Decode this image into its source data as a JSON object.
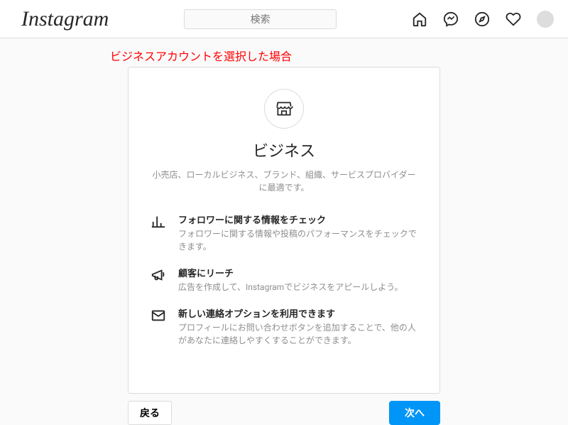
{
  "header": {
    "logo_text": "Instagram",
    "search_placeholder": "検索"
  },
  "annotation": "ビジネスアカウントを選択した場合",
  "card": {
    "title": "ビジネス",
    "subtitle": "小売店、ローカルビジネス、ブランド、組織、サービスプロバイダーに最適です。",
    "features": [
      {
        "title": "フォロワーに関する情報をチェック",
        "desc": "フォロワーに関する情報や投稿のパフォーマンスをチェックできます。"
      },
      {
        "title": "顧客にリーチ",
        "desc": "広告を作成して、Instagramでビジネスをアピールしよう。"
      },
      {
        "title": "新しい連絡オプションを利用できます",
        "desc": "プロフィールにお問い合わせボタンを追加することで、他の人があなたに連絡しやすくすることができます。"
      }
    ]
  },
  "buttons": {
    "back": "戻る",
    "next": "次へ"
  }
}
